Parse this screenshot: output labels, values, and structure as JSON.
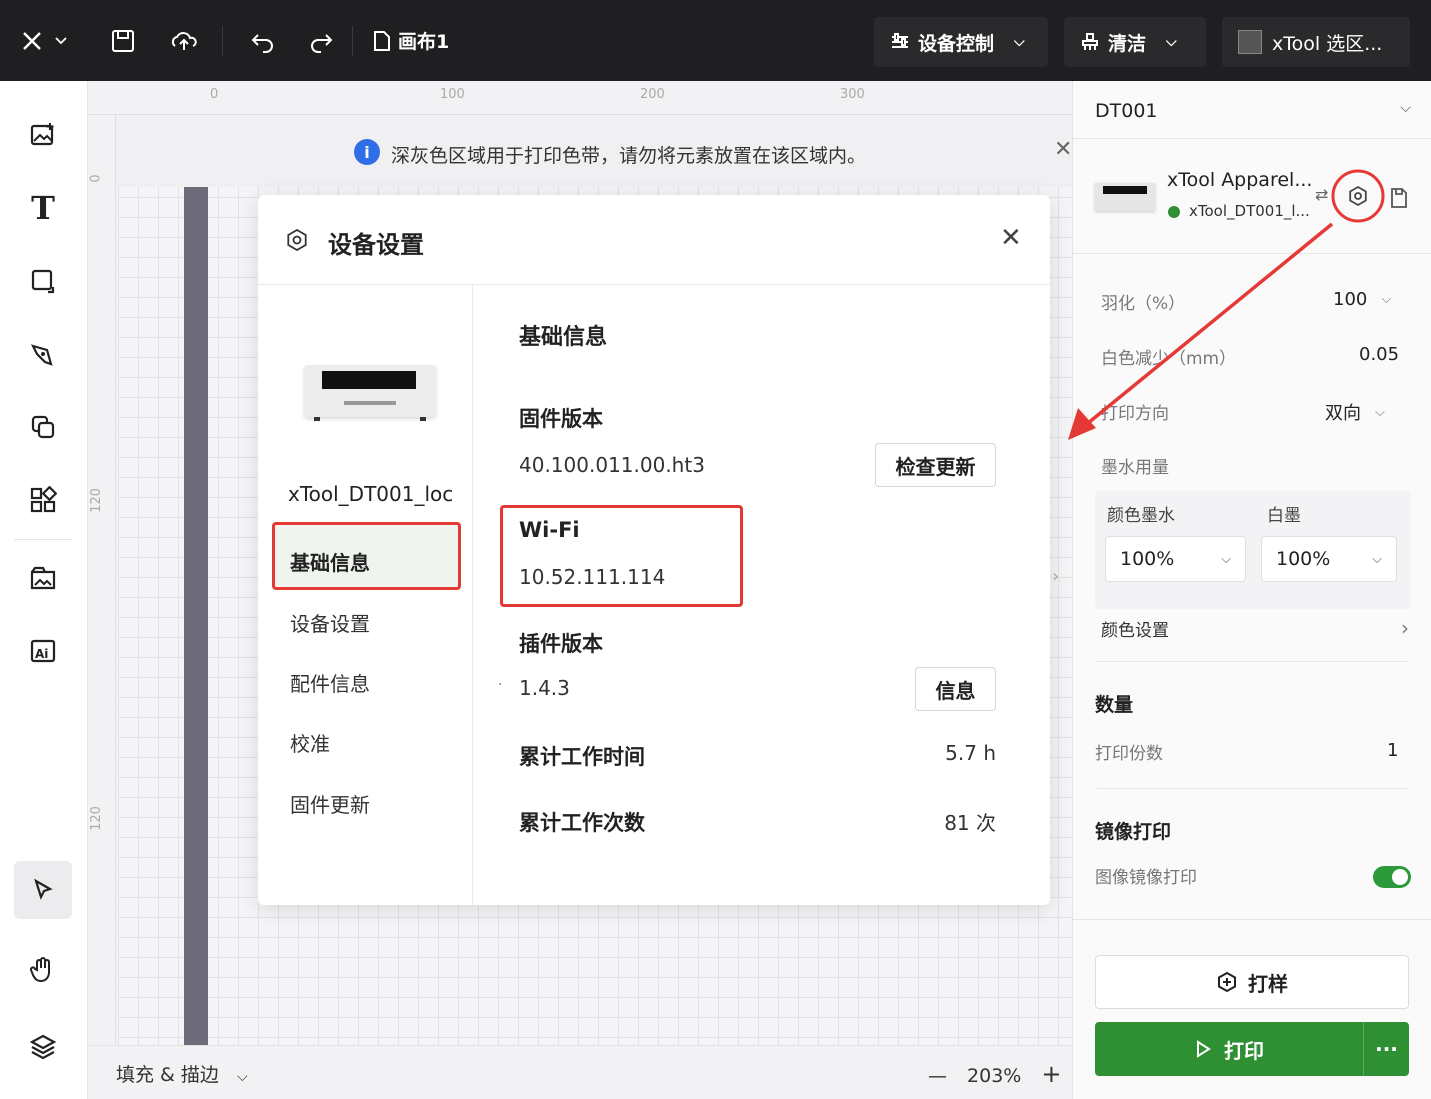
{
  "topbar": {
    "canvas_name": "画布1",
    "device_control": "设备控制",
    "clean": "清洁",
    "app_select": "xTool 选区..."
  },
  "notice": {
    "text": "深灰色区域用于打印色带，请勿将元素放置在该区域内。"
  },
  "ruler": {
    "top": [
      "0",
      "100",
      "200",
      "300"
    ],
    "left": [
      "0",
      "120",
      "120"
    ]
  },
  "bottombar": {
    "fill_stroke": "填充 & 描边",
    "zoom": "203%"
  },
  "dialog": {
    "title": "设备设置",
    "device_name": "xTool_DT001_loc",
    "nav": [
      "基础信息",
      "设备设置",
      "配件信息",
      "校准",
      "固件更新"
    ],
    "section_title": "基础信息",
    "firmware_label": "固件版本",
    "firmware_value": "40.100.011.00.ht3",
    "check_update": "检查更新",
    "wifi_label": "Wi-Fi",
    "wifi_value": "10.52.111.114",
    "plugin_label": "插件版本",
    "plugin_value": "1.4.3",
    "info_button": "信息",
    "work_time_label": "累计工作时间",
    "work_time_value": "5.7 h",
    "work_count_label": "累计工作次数",
    "work_count_value": "81 次"
  },
  "rightpanel": {
    "device_select": "DT001",
    "device_title": "xTool Apparel...",
    "device_conn": "xTool_DT001_l...",
    "feather_label": "羽化（%）",
    "feather_value": "100",
    "white_reduce_label": "白色减少（mm）",
    "white_reduce_value": "0.05",
    "print_dir_label": "打印方向",
    "print_dir_value": "双向",
    "ink_usage": "墨水用量",
    "color_ink_label": "颜色墨水",
    "color_ink_value": "100%",
    "white_ink_label": "白墨",
    "white_ink_value": "100%",
    "color_settings": "颜色设置",
    "quantity_heading": "数量",
    "copies_label": "打印份数",
    "copies_value": "1",
    "mirror_heading": "镜像打印",
    "mirror_label": "图像镜像打印",
    "sample_button": "打样",
    "print_button": "打印"
  },
  "colors": {
    "accent_green": "#2e8f33",
    "annotation_red": "#e53935",
    "topbar_bg": "#1f1f21",
    "info_blue": "#2f6ee6"
  }
}
